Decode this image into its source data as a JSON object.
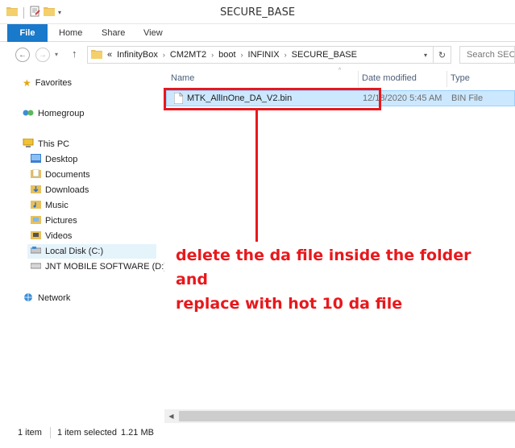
{
  "window": {
    "title": "SECURE_BASE"
  },
  "ribbon": {
    "file": "File",
    "home": "Home",
    "share": "Share",
    "view": "View"
  },
  "address": {
    "overflow": "«",
    "segments": [
      "InfinityBox",
      "CM2MT2",
      "boot",
      "INFINIX",
      "SECURE_BASE"
    ]
  },
  "search": {
    "placeholder": "Search SECU"
  },
  "nav": {
    "favorites": "Favorites",
    "homegroup": "Homegroup",
    "this_pc": "This PC",
    "desktop": "Desktop",
    "documents": "Documents",
    "downloads": "Downloads",
    "music": "Music",
    "pictures": "Pictures",
    "videos": "Videos",
    "local_disk": "Local Disk (C:)",
    "jnt": "JNT MOBILE SOFTWARE (D:)",
    "network": "Network"
  },
  "columns": {
    "name": "Name",
    "date": "Date modified",
    "type": "Type"
  },
  "files": [
    {
      "name": "MTK_AllInOne_DA_V2.bin",
      "date": "12/18/2020 5:45 AM",
      "type": "BIN File"
    }
  ],
  "annotation": {
    "line1": "delete the da file inside the folder and",
    "line2": "replace with hot 10 da file"
  },
  "status": {
    "count": "1 item",
    "selected": "1 item selected",
    "size": "1.21 MB"
  },
  "colors": {
    "accent": "#1979ca",
    "annotation": "#e8181c",
    "selection": "#cce8ff"
  }
}
